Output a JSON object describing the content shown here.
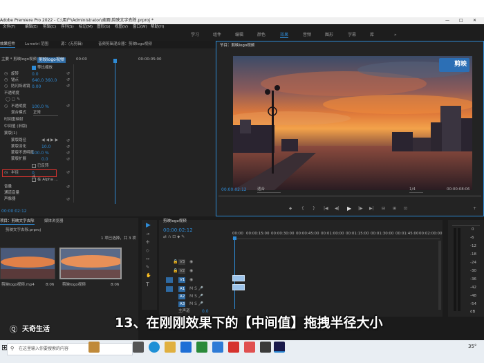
{
  "window": {
    "title": "Adobe Premiere Pro 2022 - C:\\用户\\Administrator\\桌面\\剪映文字去除.prproj *",
    "controls": [
      "—",
      "□",
      "✕"
    ]
  },
  "menu": {
    "items": [
      "文件(F)",
      "编辑(E)",
      "剪辑(C)",
      "序列(S)",
      "标记(M)",
      "图形(G)",
      "视图(V)",
      "窗口(W)",
      "帮助(H)"
    ]
  },
  "workspaces": {
    "items": [
      "学习",
      "组件",
      "编辑",
      "颜色",
      "效果",
      "音频",
      "图形",
      "字幕",
      "库"
    ],
    "active": "效果",
    "more": "»"
  },
  "effect_controls": {
    "tabs": [
      "效果控件",
      "Lumetri 范围",
      "源：(无剪辑)",
      "音频剪辑混合器：剪映logo视频"
    ],
    "source": "主要 * 剪映logo视频",
    "clip_chip": "剪映logo视频",
    "timecode_ruler": [
      "00:00",
      "00:00:05:00"
    ],
    "rows": [
      {
        "label": "等比缩放",
        "value": ""
      },
      {
        "label": "旋转",
        "value": "0.0"
      },
      {
        "label": "锚点",
        "value": "640.0   360.0"
      },
      {
        "label": "防闪烁滤镜",
        "value": "0.00"
      },
      {
        "label": "不透明度",
        "value": ""
      },
      {
        "label": "不透明度",
        "value": "100.0 %"
      },
      {
        "label": "混合模式",
        "value": "正常"
      },
      {
        "label": "时间重映射",
        "value": ""
      },
      {
        "label": "中间值 (旧版)",
        "value": ""
      },
      {
        "label": "蒙版(1)",
        "value": ""
      },
      {
        "label": "蒙版路径",
        "value": ""
      },
      {
        "label": "蒙版羽化",
        "value": "10.0"
      },
      {
        "label": "蒙版不透明度",
        "value": "100.0 %"
      },
      {
        "label": "蒙版扩展",
        "value": "0.0"
      },
      {
        "label": "已反转",
        "value": ""
      },
      {
        "label": "半径",
        "value": "0"
      },
      {
        "label": "在 Alpha ...",
        "value": ""
      },
      {
        "label": "音量",
        "value": ""
      },
      {
        "label": "通道音量",
        "value": ""
      },
      {
        "label": "声像器",
        "value": ""
      }
    ],
    "footer_time": "00:00:02:12"
  },
  "program": {
    "tab": "节目：剪映logo视频",
    "timecode": "00:00:02:12",
    "fit": "适合",
    "quality": "1/4",
    "duration": "00:00:08:06",
    "watermark": "剪映",
    "transport": [
      "⬥",
      "{",
      "}",
      "|◀",
      "◀|",
      "▶",
      "|▶",
      "▶|",
      "⊟",
      "⊞",
      "⊡",
      "+"
    ]
  },
  "project": {
    "tabs": [
      "项目：剪映文字去除",
      "媒体浏览器"
    ],
    "filename": "剪映文字去除.prproj",
    "selection_info": "1 项已选择，共 3 项",
    "items": [
      {
        "name": "剪映logo视频.mp4",
        "duration": "8:06"
      },
      {
        "name": "剪映logo视频",
        "duration": "8:06"
      }
    ]
  },
  "timeline": {
    "tab": "剪映logo视频",
    "timecode": "00:00:02:12",
    "ruler": [
      "00:00",
      "00:00:15:00",
      "00:00:30:00",
      "00:00:45:00",
      "00:01:00:00",
      "00:01:15:00",
      "00:01:30:00",
      "00:01:45:00",
      "00:02:00:00"
    ],
    "video_tracks": [
      "V3",
      "V2",
      "V1"
    ],
    "audio_tracks": [
      "A1",
      "A2",
      "A3"
    ],
    "master": "主声道",
    "master_value": "0.0"
  },
  "meters": {
    "scale": [
      "0",
      "-6",
      "-12",
      "-18",
      "-24",
      "-30",
      "-36",
      "-42",
      "-48",
      "-54",
      "dB"
    ]
  },
  "taskbar": {
    "search_placeholder": "在这里输入你要搜索的内容",
    "temperature": "35°"
  },
  "overlay": {
    "subtitle": "13、在刚刚效果下的【中间值】拖拽半径大小",
    "logo": "天奇生活"
  },
  "colors": {
    "accent": "#2e8bd6",
    "panel": "#232323",
    "clip": "#9cc3ea"
  }
}
